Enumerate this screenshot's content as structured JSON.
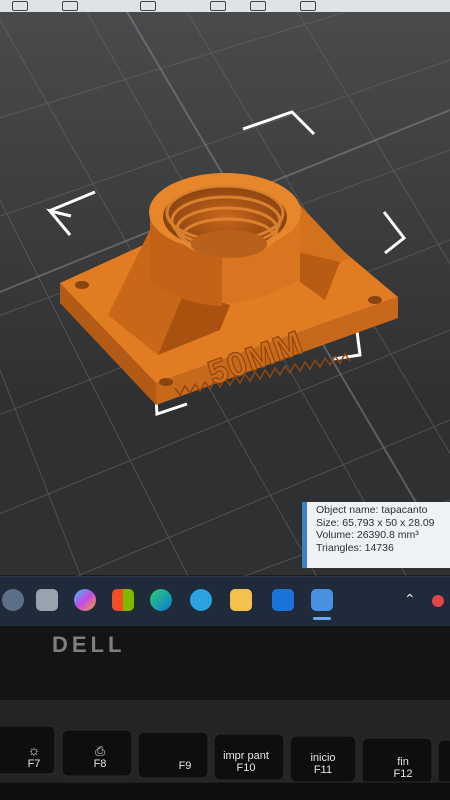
{
  "object_info": {
    "name_line": "Object name: tapacanto",
    "size_line": "Size: 65.793 x 50 x 28.09",
    "volume_line": "Volume: 26390.8 mm³",
    "triangles_line": "Triangles: 14736"
  },
  "model": {
    "embossed_text": "50MM",
    "color": "#e07a1f"
  },
  "taskbar": {
    "icons": [
      "shield-icon",
      "widgets-icon",
      "copilot-icon",
      "store-icon",
      "edge-icon",
      "telegram-icon",
      "file-explorer-icon",
      "outlook-icon",
      "3d-viewer-icon"
    ],
    "tray": [
      "chevron-up-icon",
      "network-icon"
    ]
  },
  "laptop": {
    "brand": "DELL"
  },
  "keys": [
    {
      "main": "F7",
      "sub": ""
    },
    {
      "main": "F8",
      "sub": ""
    },
    {
      "main": "F9",
      "sub": ""
    },
    {
      "main": "F10",
      "sub": "impr pant"
    },
    {
      "main": "F11",
      "sub": "inicio"
    },
    {
      "main": "F12",
      "sub": "fin"
    }
  ]
}
